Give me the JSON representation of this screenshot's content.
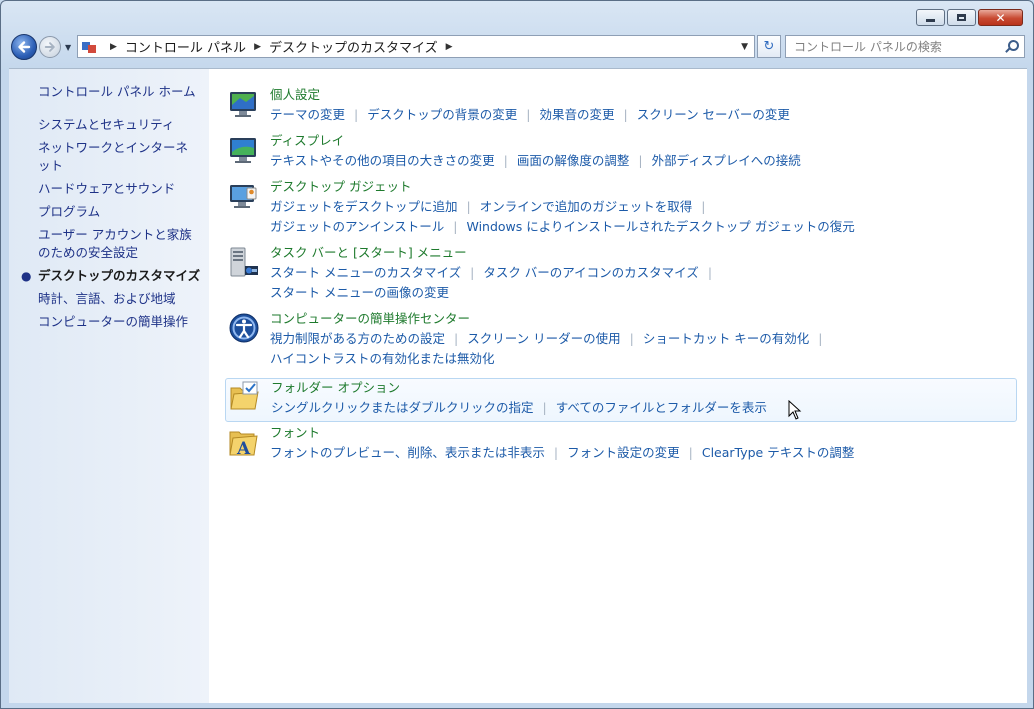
{
  "window": {
    "controls": {
      "minimize": "minimize",
      "maximize": "maximize",
      "close": "close"
    }
  },
  "navbar": {
    "breadcrumbs": [
      "コントロール パネル",
      "デスクトップのカスタマイズ"
    ],
    "search_placeholder": "コントロール パネルの検索"
  },
  "sidebar": {
    "items": [
      {
        "label": "コントロール パネル ホーム"
      },
      {
        "label": "システムとセキュリティ"
      },
      {
        "label": "ネットワークとインターネット"
      },
      {
        "label": "ハードウェアとサウンド"
      },
      {
        "label": "プログラム"
      },
      {
        "label": "ユーザー アカウントと家族のための安全設定"
      },
      {
        "label": "デスクトップのカスタマイズ",
        "current": true
      },
      {
        "label": "時計、言語、および地域"
      },
      {
        "label": "コンピューターの簡単操作"
      }
    ]
  },
  "categories": [
    {
      "title": "個人設定",
      "icon": "personalization-icon",
      "links": [
        "テーマの変更",
        "デスクトップの背景の変更",
        "効果音の変更",
        "スクリーン セーバーの変更"
      ]
    },
    {
      "title": "ディスプレイ",
      "icon": "display-icon",
      "links": [
        "テキストやその他の項目の大きさの変更",
        "画面の解像度の調整",
        "外部ディスプレイへの接続"
      ]
    },
    {
      "title": "デスクトップ ガジェット",
      "icon": "gadgets-icon",
      "links": [
        "ガジェットをデスクトップに追加",
        "オンラインで追加のガジェットを取得",
        "ガジェットのアンインストール",
        "Windows によりインストールされたデスクトップ ガジェットの復元"
      ]
    },
    {
      "title": "タスク バーと [スタート] メニュー",
      "icon": "taskbar-icon",
      "links": [
        "スタート メニューのカスタマイズ",
        "タスク バーのアイコンのカスタマイズ",
        "スタート メニューの画像の変更"
      ]
    },
    {
      "title": "コンピューターの簡単操作センター",
      "icon": "ease-of-access-icon",
      "links": [
        "視力制限がある方のための設定",
        "スクリーン リーダーの使用",
        "ショートカット キーの有効化",
        "ハイコントラストの有効化または無効化"
      ]
    },
    {
      "title": "フォルダー オプション",
      "icon": "folder-options-icon",
      "links": [
        "シングルクリックまたはダブルクリックの指定",
        "すべてのファイルとフォルダーを表示"
      ]
    },
    {
      "title": "フォント",
      "icon": "fonts-icon",
      "links": [
        "フォントのプレビュー、削除、表示または非表示",
        "フォント設定の変更",
        "ClearType テキストの調整"
      ]
    }
  ]
}
